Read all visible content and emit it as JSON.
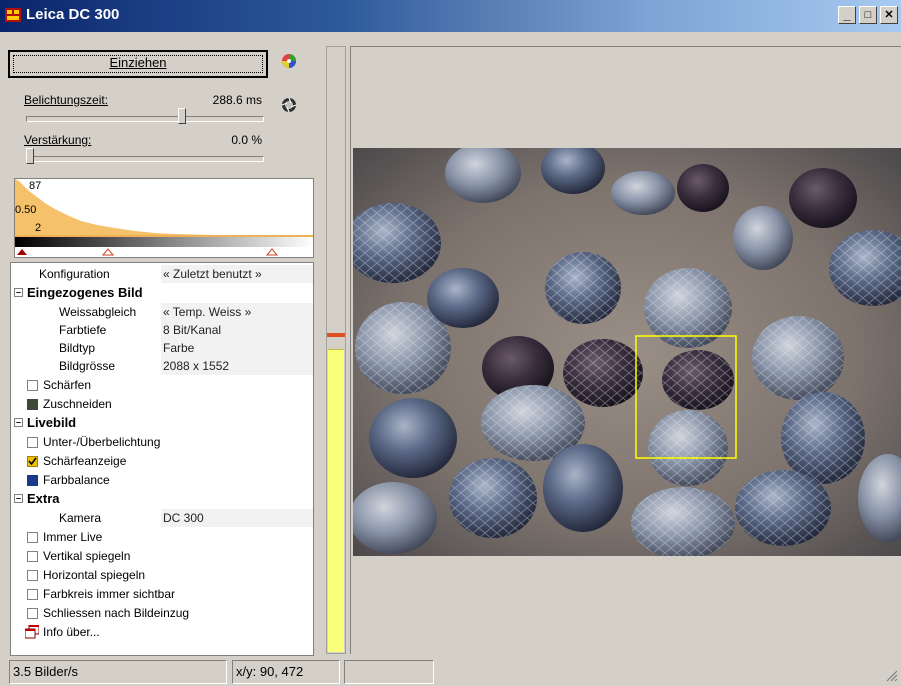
{
  "window": {
    "title": "Leica DC 300",
    "minimize": "_",
    "maximize": "□",
    "close": "✕"
  },
  "controls": {
    "capture_button": "Einziehen",
    "exposure_label": "Belichtungszeit:",
    "exposure_value": "288.6 ms",
    "exposure_level": 0.66,
    "gain_label": "Verstärkung:",
    "gain_value": "0.0 %",
    "gain_level": 0.0
  },
  "histogram": {
    "label_top": "87",
    "label_mid": "0.50",
    "label_low": "2"
  },
  "properties": {
    "config_label": "Konfiguration",
    "config_value": "« Zuletzt benutzt »",
    "captured_section": "Eingezogenes Bild",
    "white_balance_label": "Weissabgleich",
    "white_balance_value": "« Temp. Weiss »",
    "color_depth_label": "Farbtiefe",
    "color_depth_value": "8 Bit/Kanal",
    "image_type_label": "Bildtyp",
    "image_type_value": "Farbe",
    "image_size_label": "Bildgrösse",
    "image_size_value": "2088 x 1552",
    "sharpen_label": "Schärfen",
    "crop_label": "Zuschneiden",
    "live_section": "Livebild",
    "exposure_check_label": "Unter-/Überbelichtung",
    "focus_label": "Schärfeanzeige",
    "colorbalance_label": "Farbbalance",
    "extra_section": "Extra",
    "camera_label": "Kamera",
    "camera_value": "DC 300",
    "always_live_label": "Immer Live",
    "flip_v_label": "Vertikal spiegeln",
    "flip_h_label": "Horizontal spiegeln",
    "colorwheel_label": "Farbkreis immer sichtbar",
    "close_after_label": "Schliessen nach Bildeinzug",
    "about_label": "Info über..."
  },
  "meter": {
    "level": 0.5
  },
  "status": {
    "fps": "3.5 Bilder/s",
    "coords": "x/y: 90, 472",
    "extra": ""
  },
  "colors": {
    "meter_fill": "#f8ff78",
    "histogram_fill": "#f5c26b",
    "selection": "#ffff00"
  }
}
